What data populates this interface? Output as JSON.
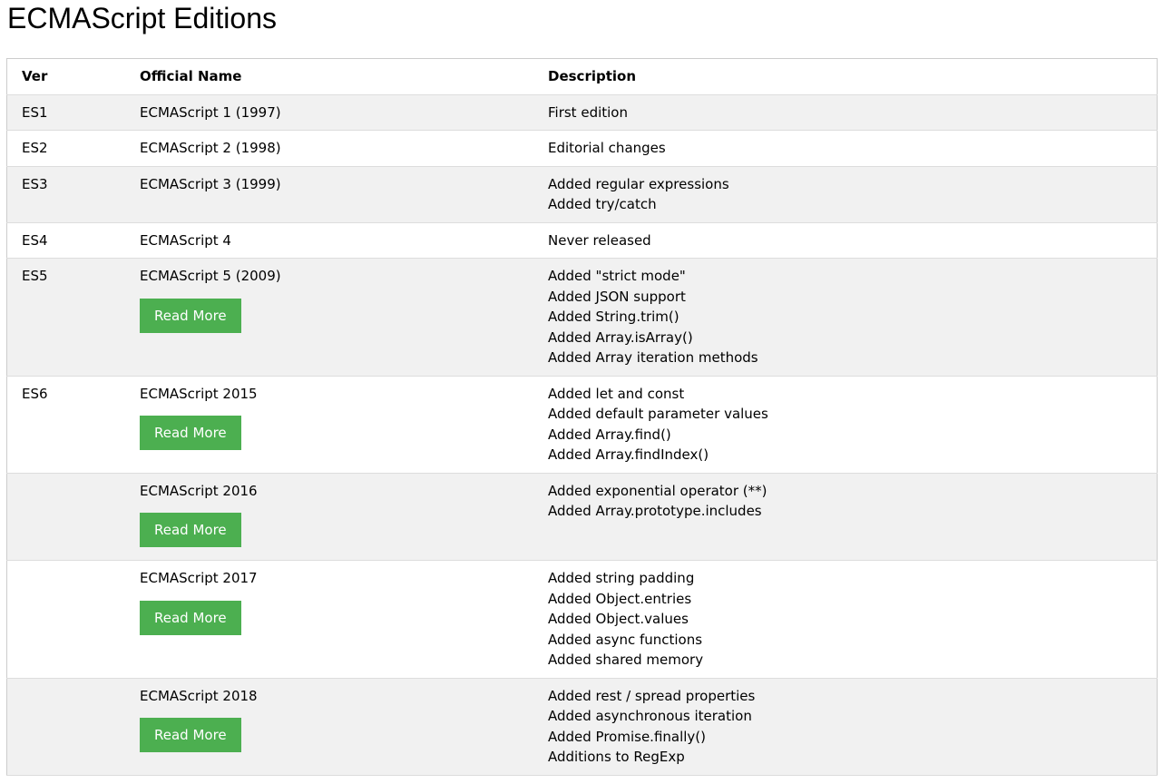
{
  "page": {
    "title": "ECMAScript Editions"
  },
  "table": {
    "headers": {
      "ver": "Ver",
      "name": "Official Name",
      "desc": "Description"
    },
    "rows": [
      {
        "ver": "ES1",
        "name": "ECMAScript 1 (1997)",
        "desc": [
          "First edition"
        ],
        "button": ""
      },
      {
        "ver": "ES2",
        "name": "ECMAScript 2 (1998)",
        "desc": [
          "Editorial changes"
        ],
        "button": ""
      },
      {
        "ver": "ES3",
        "name": "ECMAScript 3 (1999)",
        "desc": [
          "Added regular expressions",
          "Added try/catch"
        ],
        "button": ""
      },
      {
        "ver": "ES4",
        "name": "ECMAScript 4",
        "desc": [
          "Never released"
        ],
        "button": ""
      },
      {
        "ver": "ES5",
        "name": "ECMAScript 5 (2009)",
        "desc": [
          "Added \"strict mode\"",
          "Added JSON support",
          "Added String.trim()",
          "Added Array.isArray()",
          "Added Array iteration methods"
        ],
        "button": "Read More"
      },
      {
        "ver": "ES6",
        "name": "ECMAScript 2015",
        "desc": [
          "Added let and const",
          "Added default parameter values",
          "Added Array.find()",
          "Added Array.findIndex()"
        ],
        "button": "Read More"
      },
      {
        "ver": "",
        "name": "ECMAScript 2016",
        "desc": [
          "Added exponential operator (**)",
          "Added Array.prototype.includes"
        ],
        "button": "Read More"
      },
      {
        "ver": "",
        "name": "ECMAScript 2017",
        "desc": [
          "Added string padding",
          "Added Object.entries",
          "Added Object.values",
          "Added async functions",
          "Added shared memory"
        ],
        "button": "Read More"
      },
      {
        "ver": "",
        "name": "ECMAScript 2018",
        "desc": [
          "Added rest / spread properties",
          "Added asynchronous iteration",
          "Added Promise.finally()",
          "Additions to RegExp"
        ],
        "button": "Read More"
      }
    ]
  }
}
